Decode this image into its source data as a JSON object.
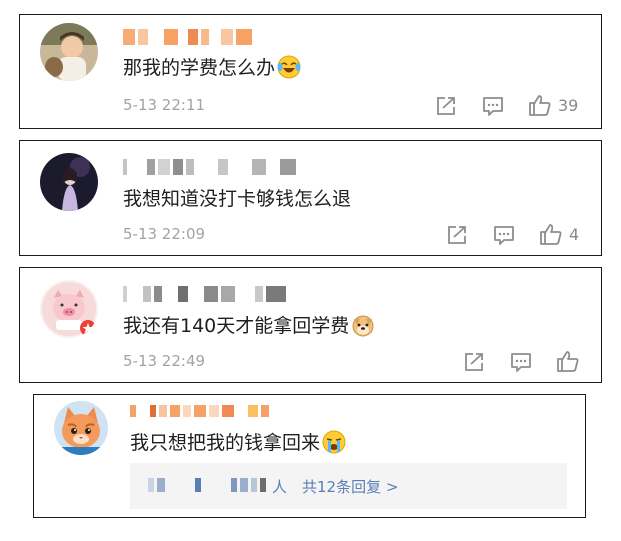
{
  "comments": [
    {
      "text": "那我的学费怎么办",
      "emoji": "laugh-cry-emoji",
      "time": "5-13 22:11",
      "likes": "39"
    },
    {
      "text": "我想知道没打卡够钱怎么退",
      "time": "5-13 22:09",
      "likes": "4"
    },
    {
      "text": "我还有140天才能拿回学费",
      "emoji": "doge-emoji",
      "time": "5-13 22:49",
      "likes": ""
    },
    {
      "text": "我只想把我的钱拿回来",
      "emoji": "crying-emoji",
      "reply_suffix": "人",
      "reply_link": "共12条回复 >"
    }
  ],
  "colors": {
    "name_orange": "#f6a266",
    "name_gray": "#b9b9b9",
    "link": "#5b7fb5",
    "icon": "#8d8d8d"
  }
}
